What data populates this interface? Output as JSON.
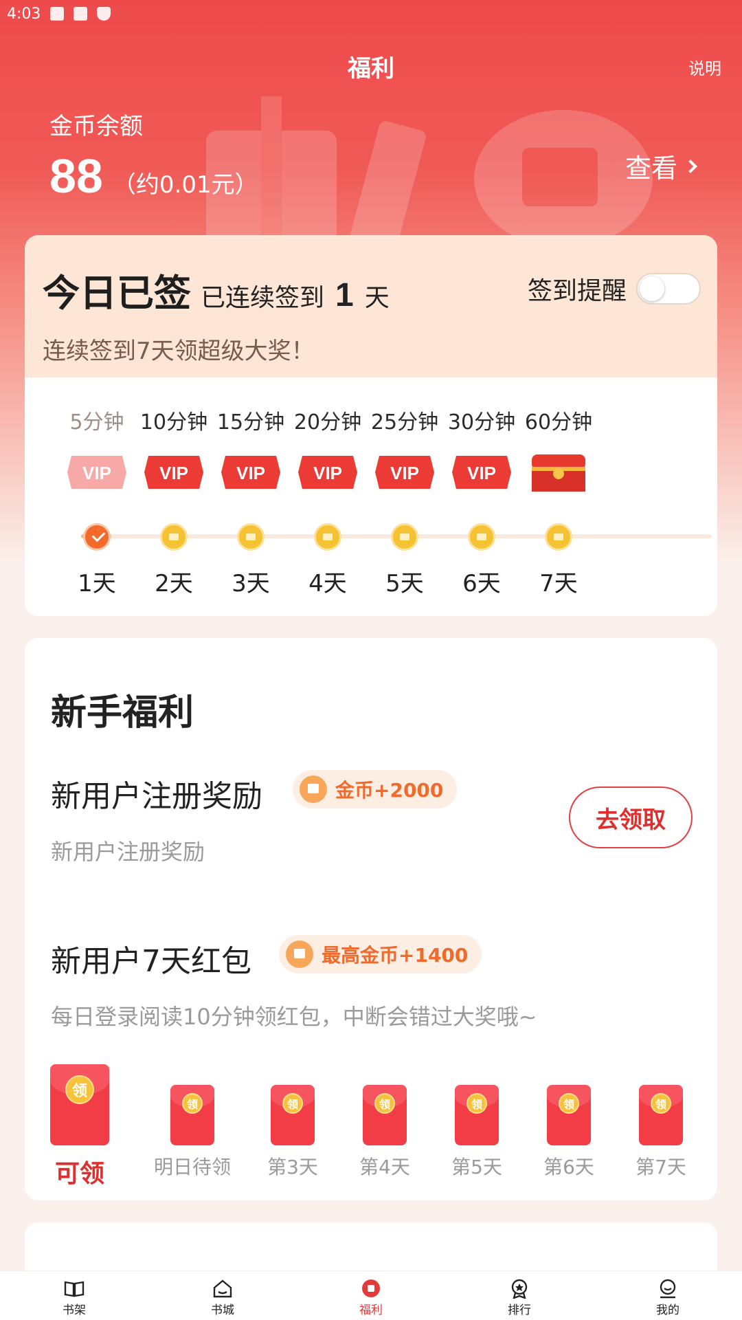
{
  "status_bar": {
    "time": "4:03"
  },
  "header": {
    "title": "福利",
    "explain": "说明"
  },
  "balance": {
    "label": "金币余额",
    "value": "88",
    "approx": "（约0.01元）",
    "view": "查看"
  },
  "sign": {
    "today": "今日已签",
    "streak_prefix": "已连续签到",
    "streak_days": "1",
    "streak_unit": "天",
    "subtitle": "连续签到7天领超级大奖！",
    "reminder_label": "签到提醒",
    "reminder_on": false,
    "days": [
      {
        "time": "5分钟",
        "day": "1天",
        "reward": "VIP",
        "status": "done"
      },
      {
        "time": "10分钟",
        "day": "2天",
        "reward": "VIP",
        "status": "pending"
      },
      {
        "time": "15分钟",
        "day": "3天",
        "reward": "VIP",
        "status": "pending"
      },
      {
        "time": "20分钟",
        "day": "4天",
        "reward": "VIP",
        "status": "pending"
      },
      {
        "time": "25分钟",
        "day": "5天",
        "reward": "VIP",
        "status": "pending"
      },
      {
        "time": "30分钟",
        "day": "6天",
        "reward": "VIP",
        "status": "pending"
      },
      {
        "time": "60分钟",
        "day": "7天",
        "reward": "treasure-chest",
        "status": "pending"
      }
    ]
  },
  "newbie": {
    "title": "新手福利",
    "tasks": [
      {
        "title": "新用户注册奖励",
        "badge": "金币+2000",
        "desc": "新用户注册奖励",
        "button": "去领取"
      },
      {
        "title": "新用户7天红包",
        "badge": "最高金币+1400",
        "desc": "每日登录阅读10分钟领红包，中断会错过大奖哦~"
      }
    ],
    "envelope_coin_char": "领",
    "envelopes": [
      "可领",
      "明日待领",
      "第3天",
      "第4天",
      "第5天",
      "第6天",
      "第7天"
    ]
  },
  "nav": {
    "items": [
      {
        "label": "书架",
        "icon": "bookshelf-icon"
      },
      {
        "label": "书城",
        "icon": "bookstore-icon"
      },
      {
        "label": "福利",
        "icon": "welfare-icon",
        "active": true
      },
      {
        "label": "排行",
        "icon": "ranking-icon"
      },
      {
        "label": "我的",
        "icon": "profile-icon"
      }
    ]
  },
  "colors": {
    "accent": "#e33a3a",
    "header_bg": "#ee4a4b",
    "sign_header_bg": "#fde6d6"
  }
}
